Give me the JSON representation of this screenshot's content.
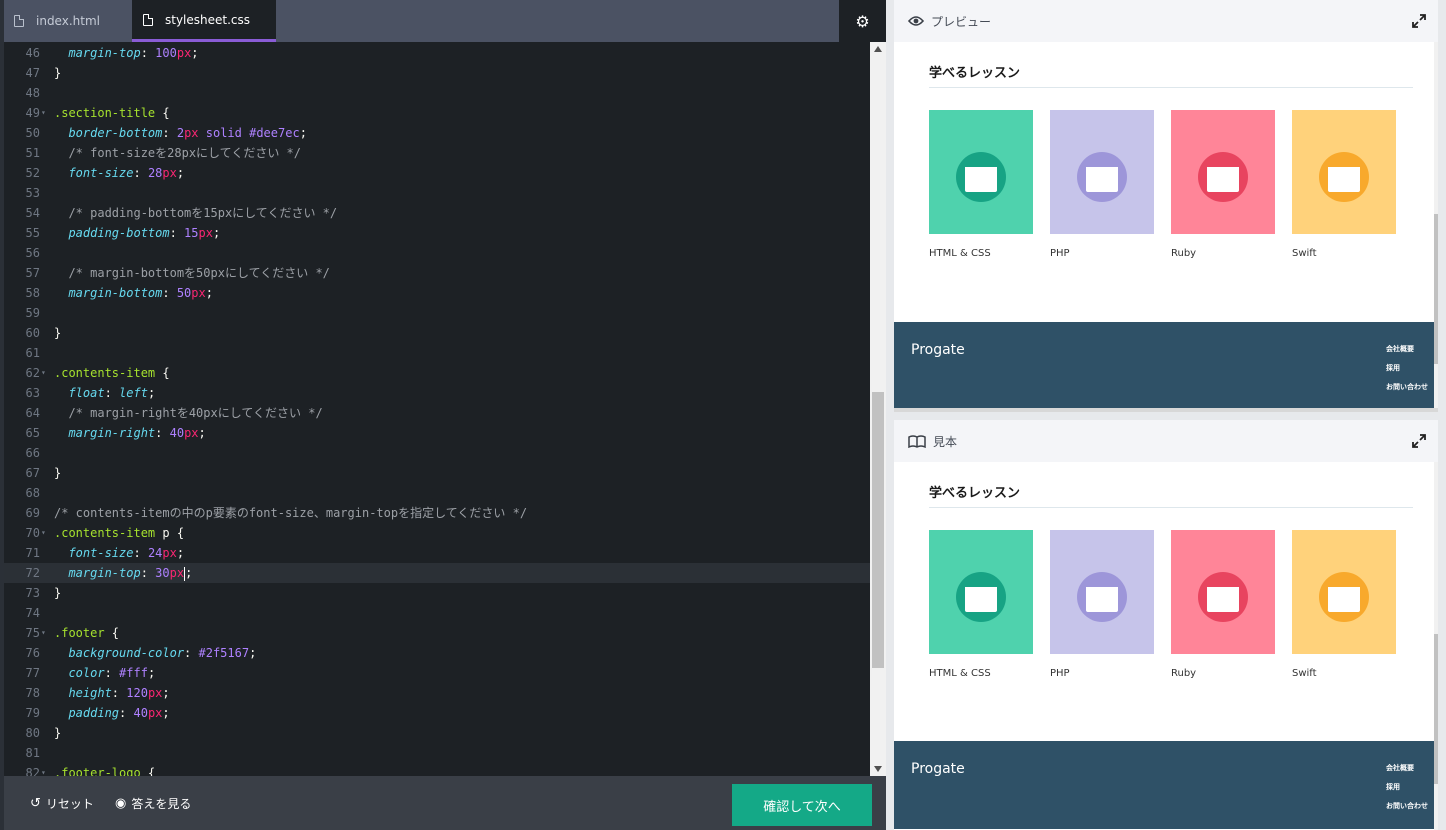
{
  "tabs": [
    {
      "label": "index.html",
      "active": false
    },
    {
      "label": "stylesheet.css",
      "active": true
    }
  ],
  "code_lines": [
    {
      "n": "46",
      "fold": false,
      "tokens": [
        [
          "prop",
          "  margin-top"
        ],
        [
          "pn",
          ": "
        ],
        [
          "num",
          "100"
        ],
        [
          "unit",
          "px"
        ],
        [
          "pn",
          ";"
        ]
      ]
    },
    {
      "n": "47",
      "fold": false,
      "tokens": [
        [
          "pn",
          "}"
        ]
      ]
    },
    {
      "n": "48",
      "fold": false,
      "tokens": []
    },
    {
      "n": "49",
      "fold": true,
      "tokens": [
        [
          "sel",
          ".section-title"
        ],
        [
          "pn",
          " {"
        ]
      ]
    },
    {
      "n": "50",
      "fold": false,
      "tokens": [
        [
          "prop",
          "  border-bottom"
        ],
        [
          "pn",
          ": "
        ],
        [
          "num",
          "2"
        ],
        [
          "unit",
          "px"
        ],
        [
          "pn",
          " "
        ],
        [
          "kw",
          "solid"
        ],
        [
          "pn",
          " "
        ],
        [
          "num",
          "#dee7ec"
        ],
        [
          "pn",
          ";"
        ]
      ]
    },
    {
      "n": "51",
      "fold": false,
      "tokens": [
        [
          "cm",
          "  /* font-sizeを28pxにしてください */"
        ]
      ]
    },
    {
      "n": "52",
      "fold": false,
      "tokens": [
        [
          "prop",
          "  font-size"
        ],
        [
          "pn",
          ": "
        ],
        [
          "num",
          "28"
        ],
        [
          "unit",
          "px"
        ],
        [
          "pn",
          ";"
        ]
      ]
    },
    {
      "n": "53",
      "fold": false,
      "tokens": []
    },
    {
      "n": "54",
      "fold": false,
      "tokens": [
        [
          "cm",
          "  /* padding-bottomを15pxにしてください */"
        ]
      ]
    },
    {
      "n": "55",
      "fold": false,
      "tokens": [
        [
          "prop",
          "  padding-bottom"
        ],
        [
          "pn",
          ": "
        ],
        [
          "num",
          "15"
        ],
        [
          "unit",
          "px"
        ],
        [
          "pn",
          ";"
        ]
      ]
    },
    {
      "n": "56",
      "fold": false,
      "tokens": []
    },
    {
      "n": "57",
      "fold": false,
      "tokens": [
        [
          "cm",
          "  /* margin-bottomを50pxにしてください */"
        ]
      ]
    },
    {
      "n": "58",
      "fold": false,
      "tokens": [
        [
          "prop",
          "  margin-bottom"
        ],
        [
          "pn",
          ": "
        ],
        [
          "num",
          "50"
        ],
        [
          "unit",
          "px"
        ],
        [
          "pn",
          ";"
        ]
      ]
    },
    {
      "n": "59",
      "fold": false,
      "tokens": []
    },
    {
      "n": "60",
      "fold": false,
      "tokens": [
        [
          "pn",
          "}"
        ]
      ]
    },
    {
      "n": "61",
      "fold": false,
      "tokens": []
    },
    {
      "n": "62",
      "fold": true,
      "tokens": [
        [
          "sel",
          ".contents-item"
        ],
        [
          "pn",
          " {"
        ]
      ]
    },
    {
      "n": "63",
      "fold": false,
      "tokens": [
        [
          "prop",
          "  float"
        ],
        [
          "pn",
          ": "
        ],
        [
          "prop",
          "left"
        ],
        [
          "pn",
          ";"
        ]
      ]
    },
    {
      "n": "64",
      "fold": false,
      "tokens": [
        [
          "cm",
          "  /* margin-rightを40pxにしてください */"
        ]
      ]
    },
    {
      "n": "65",
      "fold": false,
      "tokens": [
        [
          "prop",
          "  margin-right"
        ],
        [
          "pn",
          ": "
        ],
        [
          "num",
          "40"
        ],
        [
          "unit",
          "px"
        ],
        [
          "pn",
          ";"
        ]
      ]
    },
    {
      "n": "66",
      "fold": false,
      "tokens": []
    },
    {
      "n": "67",
      "fold": false,
      "tokens": [
        [
          "pn",
          "}"
        ]
      ]
    },
    {
      "n": "68",
      "fold": false,
      "tokens": []
    },
    {
      "n": "69",
      "fold": false,
      "tokens": [
        [
          "cm",
          "/* contents-itemの中のp要素のfont-size、margin-topを指定してください */"
        ]
      ]
    },
    {
      "n": "70",
      "fold": true,
      "tokens": [
        [
          "sel",
          ".contents-item"
        ],
        [
          "pn",
          " p {"
        ]
      ]
    },
    {
      "n": "71",
      "fold": false,
      "tokens": [
        [
          "prop",
          "  font-size"
        ],
        [
          "pn",
          ": "
        ],
        [
          "num",
          "24"
        ],
        [
          "unit",
          "px"
        ],
        [
          "pn",
          ";"
        ]
      ]
    },
    {
      "n": "72",
      "fold": false,
      "active": true,
      "tokens": [
        [
          "prop",
          "  margin-top"
        ],
        [
          "pn",
          ": "
        ],
        [
          "num",
          "30"
        ],
        [
          "unit",
          "px"
        ],
        [
          "cursor",
          ""
        ],
        [
          "pn",
          ";"
        ]
      ]
    },
    {
      "n": "73",
      "fold": false,
      "tokens": [
        [
          "pn",
          "}"
        ]
      ]
    },
    {
      "n": "74",
      "fold": false,
      "tokens": []
    },
    {
      "n": "75",
      "fold": true,
      "tokens": [
        [
          "sel",
          ".footer"
        ],
        [
          "pn",
          " {"
        ]
      ]
    },
    {
      "n": "76",
      "fold": false,
      "tokens": [
        [
          "prop",
          "  background-color"
        ],
        [
          "pn",
          ": "
        ],
        [
          "num",
          "#2f5167"
        ],
        [
          "pn",
          ";"
        ]
      ]
    },
    {
      "n": "77",
      "fold": false,
      "tokens": [
        [
          "prop",
          "  color"
        ],
        [
          "pn",
          ": "
        ],
        [
          "num",
          "#fff"
        ],
        [
          "pn",
          ";"
        ]
      ]
    },
    {
      "n": "78",
      "fold": false,
      "tokens": [
        [
          "prop",
          "  height"
        ],
        [
          "pn",
          ": "
        ],
        [
          "num",
          "120"
        ],
        [
          "unit",
          "px"
        ],
        [
          "pn",
          ";"
        ]
      ]
    },
    {
      "n": "79",
      "fold": false,
      "tokens": [
        [
          "prop",
          "  padding"
        ],
        [
          "pn",
          ": "
        ],
        [
          "num",
          "40"
        ],
        [
          "unit",
          "px"
        ],
        [
          "pn",
          ";"
        ]
      ]
    },
    {
      "n": "80",
      "fold": false,
      "tokens": [
        [
          "pn",
          "}"
        ]
      ]
    },
    {
      "n": "81",
      "fold": false,
      "tokens": []
    },
    {
      "n": "82",
      "fold": true,
      "tokens": [
        [
          "sel",
          ".footer-logo"
        ],
        [
          "pn",
          " {"
        ]
      ]
    }
  ],
  "bottombar": {
    "reset_label": "リセット",
    "answer_label": "答えを見る",
    "next_label": "確認して次へ"
  },
  "preview": {
    "title": "プレビュー",
    "lesson_heading": "学べるレッスン",
    "footer_logo": "Progate",
    "footer_links": [
      "会社概要",
      "採用",
      "お問い合わせ"
    ]
  },
  "sample": {
    "title": "見本",
    "lesson_heading": "学べるレッスン",
    "footer_logo": "Progate",
    "footer_links": [
      "会社概要",
      "採用",
      "お問い合わせ"
    ]
  },
  "lessons": [
    {
      "label": "HTML & CSS",
      "bg": "#4fd2ad",
      "circle": "#17a384",
      "icon": "code-doc-icon"
    },
    {
      "label": "PHP",
      "bg": "#c6c4ea",
      "circle": "#9d96d9",
      "icon": "elephant-icon"
    },
    {
      "label": "Ruby",
      "bg": "#ff8598",
      "circle": "#e8445f",
      "icon": "gem-icon"
    },
    {
      "label": "Swift",
      "bg": "#ffd27b",
      "circle": "#f8a92c",
      "icon": "swift-bird-icon"
    }
  ],
  "colors": {
    "editor_bg": "#1d2125",
    "tabbar_bg": "#4b5263",
    "active_tab_border": "#8a5cd6",
    "next_button": "#14a987",
    "footer_bg": "#2f5167"
  }
}
